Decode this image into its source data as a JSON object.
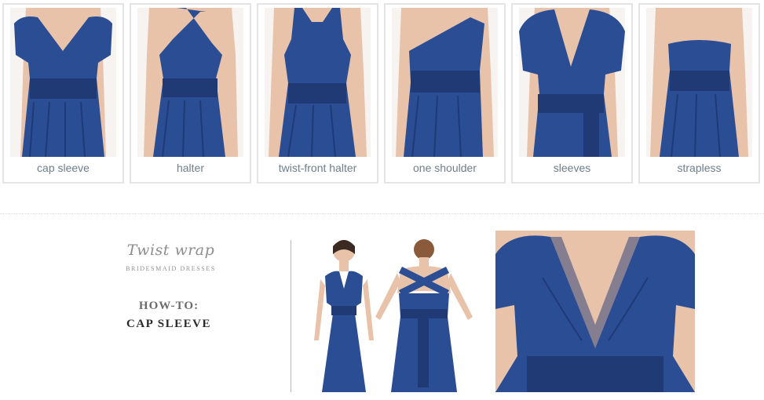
{
  "styles": [
    {
      "label": "cap sleeve"
    },
    {
      "label": "halter"
    },
    {
      "label": "twist-front halter"
    },
    {
      "label": "one shoulder"
    },
    {
      "label": "sleeves"
    },
    {
      "label": "strapless"
    }
  ],
  "colors": {
    "dress": "#2b4d93",
    "dress_shadow": "#1f3a75",
    "skin": "#e8c3aa",
    "label_text": "#6f7e8a",
    "card_border": "#e4e4e4"
  },
  "logo": {
    "script": "Twist wrap",
    "subtitle": "BRIDESMAID DRESSES"
  },
  "howto": {
    "heading": "HOW-TO:",
    "style_name": "CAP SLEEVE"
  },
  "icons": [
    "dress-photo-icon"
  ]
}
